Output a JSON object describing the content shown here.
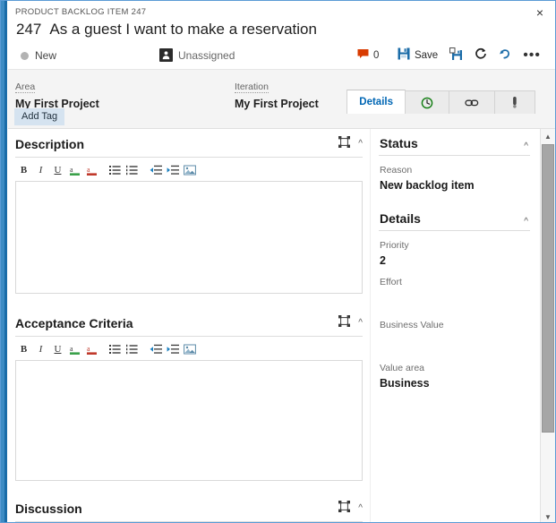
{
  "window": {
    "breadcrumb": "PRODUCT BACKLOG ITEM 247",
    "close_label": "×"
  },
  "header": {
    "work_item_id": "247",
    "title": "As a guest I want to make a reservation",
    "state": "New",
    "assignee": "Unassigned",
    "comment_count": "0",
    "actions": {
      "save_label": "Save",
      "save_and_close_name": "save-and-close",
      "refresh_name": "refresh",
      "revert_name": "undo",
      "more_label": "•••"
    }
  },
  "classification": {
    "area_label": "Area",
    "area_value": "My First Project",
    "iteration_label": "Iteration",
    "iteration_value": "My First Project",
    "add_tag_label": "Add Tag"
  },
  "tabs": [
    {
      "label": "Details",
      "icon": "",
      "active": true
    },
    {
      "label": "",
      "icon": "history-icon",
      "active": false
    },
    {
      "label": "",
      "icon": "link-icon",
      "active": false
    },
    {
      "label": "",
      "icon": "attachment-icon",
      "active": false
    }
  ],
  "sections": [
    {
      "title": "Description",
      "has_editor": true
    },
    {
      "title": "Acceptance Criteria",
      "has_editor": true
    },
    {
      "title": "Discussion",
      "has_editor": false
    }
  ],
  "rte_buttons": [
    {
      "name": "bold-button",
      "glyph": "B"
    },
    {
      "name": "italic-button",
      "glyph": "I"
    },
    {
      "name": "underline-button",
      "glyph": "U"
    },
    {
      "name": "font-color-button",
      "glyph": ""
    },
    {
      "name": "highlight-button",
      "glyph": ""
    },
    {
      "name": "bulleted-list-button",
      "glyph": ""
    },
    {
      "name": "numbered-list-button",
      "glyph": ""
    },
    {
      "name": "decrease-indent-button",
      "glyph": ""
    },
    {
      "name": "increase-indent-button",
      "glyph": ""
    },
    {
      "name": "insert-image-button",
      "glyph": ""
    }
  ],
  "panels": [
    {
      "title": "Status",
      "fields": [
        {
          "label": "Reason",
          "value": "New backlog item"
        }
      ]
    },
    {
      "title": "Details",
      "fields": [
        {
          "label": "Priority",
          "value": "2"
        },
        {
          "label": "Effort",
          "value": ""
        },
        {
          "label": "Business Value",
          "value": ""
        },
        {
          "label": "Value area",
          "value": "Business"
        }
      ]
    }
  ],
  "colors": {
    "accent_blue": "#0066b4",
    "window_border": "#5b9bd5",
    "left_bar_light": "#3e8cc4",
    "left_bar_dark": "#1b6ca8",
    "comment_red": "#d83b01",
    "state_gray": "#b3b3b3",
    "tag_bg": "#d5e3f0"
  },
  "scrollbar": {
    "up_arrow": "▲",
    "down_arrow": "▼"
  }
}
